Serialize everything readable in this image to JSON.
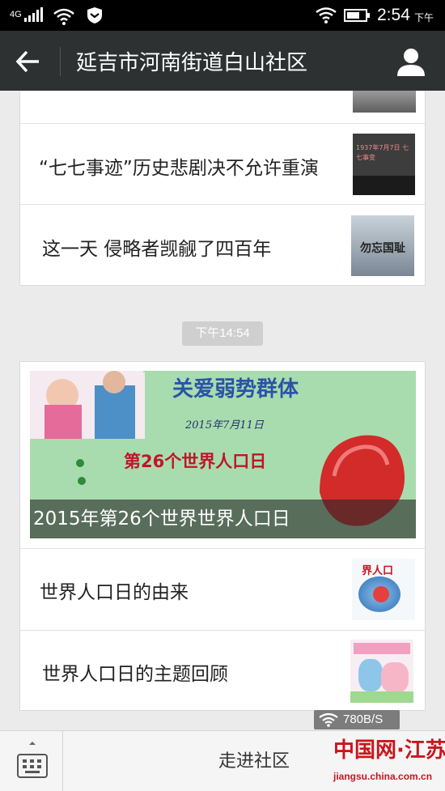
{
  "status_bar": {
    "network": "4G",
    "time": "2:54",
    "ampm": "下午",
    "icons": [
      "signal-icon",
      "wifi-icon",
      "shield-icon",
      "battery-icon"
    ]
  },
  "header": {
    "title": "延吉市河南街道白山社区",
    "back_icon": "back-arrow-icon",
    "profile_icon": "person-icon",
    "background": "#2e3132"
  },
  "feed": {
    "group1": {
      "items": [
        {
          "title": "“七七事迹”历史悲剧决不允许重演",
          "thumb_text": "1937年7月7日 七七事变"
        },
        {
          "title": "这一天 侵略者觊觎了四百年",
          "thumb_text": "勿忘国耻"
        }
      ]
    },
    "timestamp": "下午14:54",
    "group2": {
      "cover": {
        "caption": "2015年第26个世界世界人口日",
        "banner_heading": "关爱弱势群体",
        "banner_date": "2015年7月11日",
        "banner_text": "第26个世界人口日"
      },
      "items": [
        {
          "title": "世界人口日的由来",
          "thumb_text": "界人口"
        },
        {
          "title": "世界人口日的主题回顾",
          "thumb_text": ""
        }
      ]
    }
  },
  "speed_badge": {
    "text": "780B/S"
  },
  "bottom_bar": {
    "menu_label": "走进社区",
    "keyboard_icon": "keyboard-icon"
  },
  "watermark": {
    "logo": "中国网·江苏",
    "url": "jiangsu.china.com.cn"
  },
  "colors": {
    "header_bg": "#2e3132",
    "page_bg": "#ebebeb",
    "accent_red": "#c8161d"
  }
}
